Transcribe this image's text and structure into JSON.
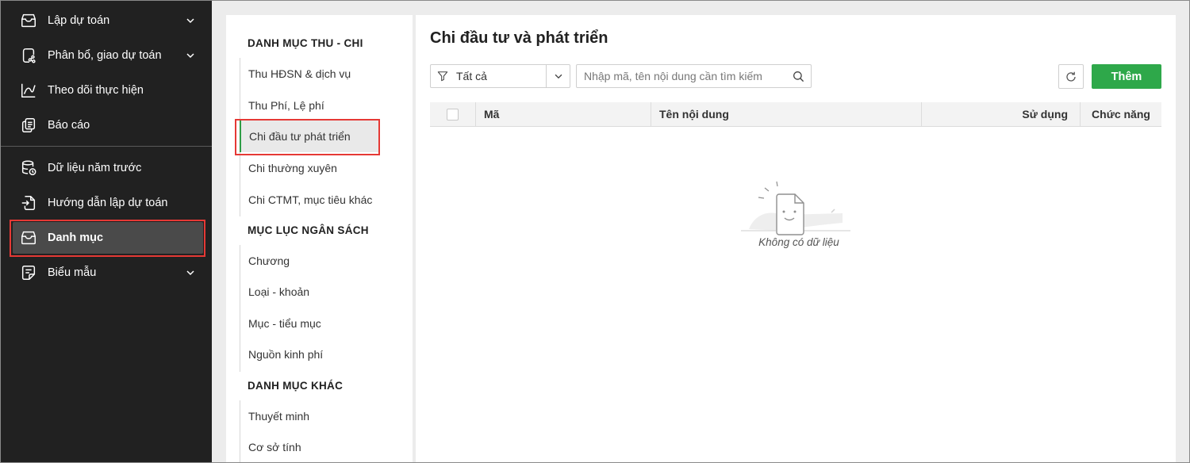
{
  "sidebar": {
    "items": [
      {
        "label": "Lập dự toán",
        "icon": "inbox-icon",
        "has_chevron": true
      },
      {
        "label": "Phân bổ, giao dự toán",
        "icon": "share-document-icon",
        "has_chevron": true
      },
      {
        "label": "Theo dõi thực hiện",
        "icon": "line-chart-icon",
        "has_chevron": false
      },
      {
        "label": "Báo cáo",
        "icon": "report-copy-icon",
        "has_chevron": false
      },
      {
        "label": "Dữ liệu năm trước",
        "icon": "database-history-icon",
        "has_chevron": false
      },
      {
        "label": "Hướng dẫn lập dự toán",
        "icon": "document-import-icon",
        "has_chevron": false
      },
      {
        "label": "Danh mục",
        "icon": "inbox-icon",
        "has_chevron": false,
        "active": true
      },
      {
        "label": "Biểu mẫu",
        "icon": "form-template-icon",
        "has_chevron": true
      }
    ]
  },
  "categories": {
    "groups": [
      {
        "title": "DANH MỤC THU - CHI",
        "items": [
          "Thu HĐSN & dịch vụ",
          "Thu Phí, Lệ phí",
          "Chi đầu tư phát triển",
          "Chi thường xuyên",
          "Chi CTMT, mục tiêu khác"
        ]
      },
      {
        "title": "MỤC LỤC NGÂN SÁCH",
        "items": [
          "Chương",
          "Loại - khoản",
          "Mục - tiểu mục",
          "Nguồn kinh phí"
        ]
      },
      {
        "title": "DANH MỤC KHÁC",
        "items": [
          "Thuyết minh",
          "Cơ sở tính"
        ]
      }
    ],
    "active_item": "Chi đầu tư phát triển"
  },
  "main": {
    "title": "Chi đầu tư và phát triển",
    "filter": {
      "value": "Tất cả"
    },
    "search": {
      "placeholder": "Nhập mã, tên nội dung cần tìm kiếm"
    },
    "add_label": "Thêm",
    "columns": {
      "code": "Mã",
      "name": "Tên nội dung",
      "usage": "Sử dụng",
      "actions": "Chức năng"
    },
    "empty_text": "Không có dữ liệu"
  },
  "colors": {
    "sidebar_bg": "#212121",
    "accent_green": "#2ea84a",
    "highlight_red": "#e53935"
  }
}
